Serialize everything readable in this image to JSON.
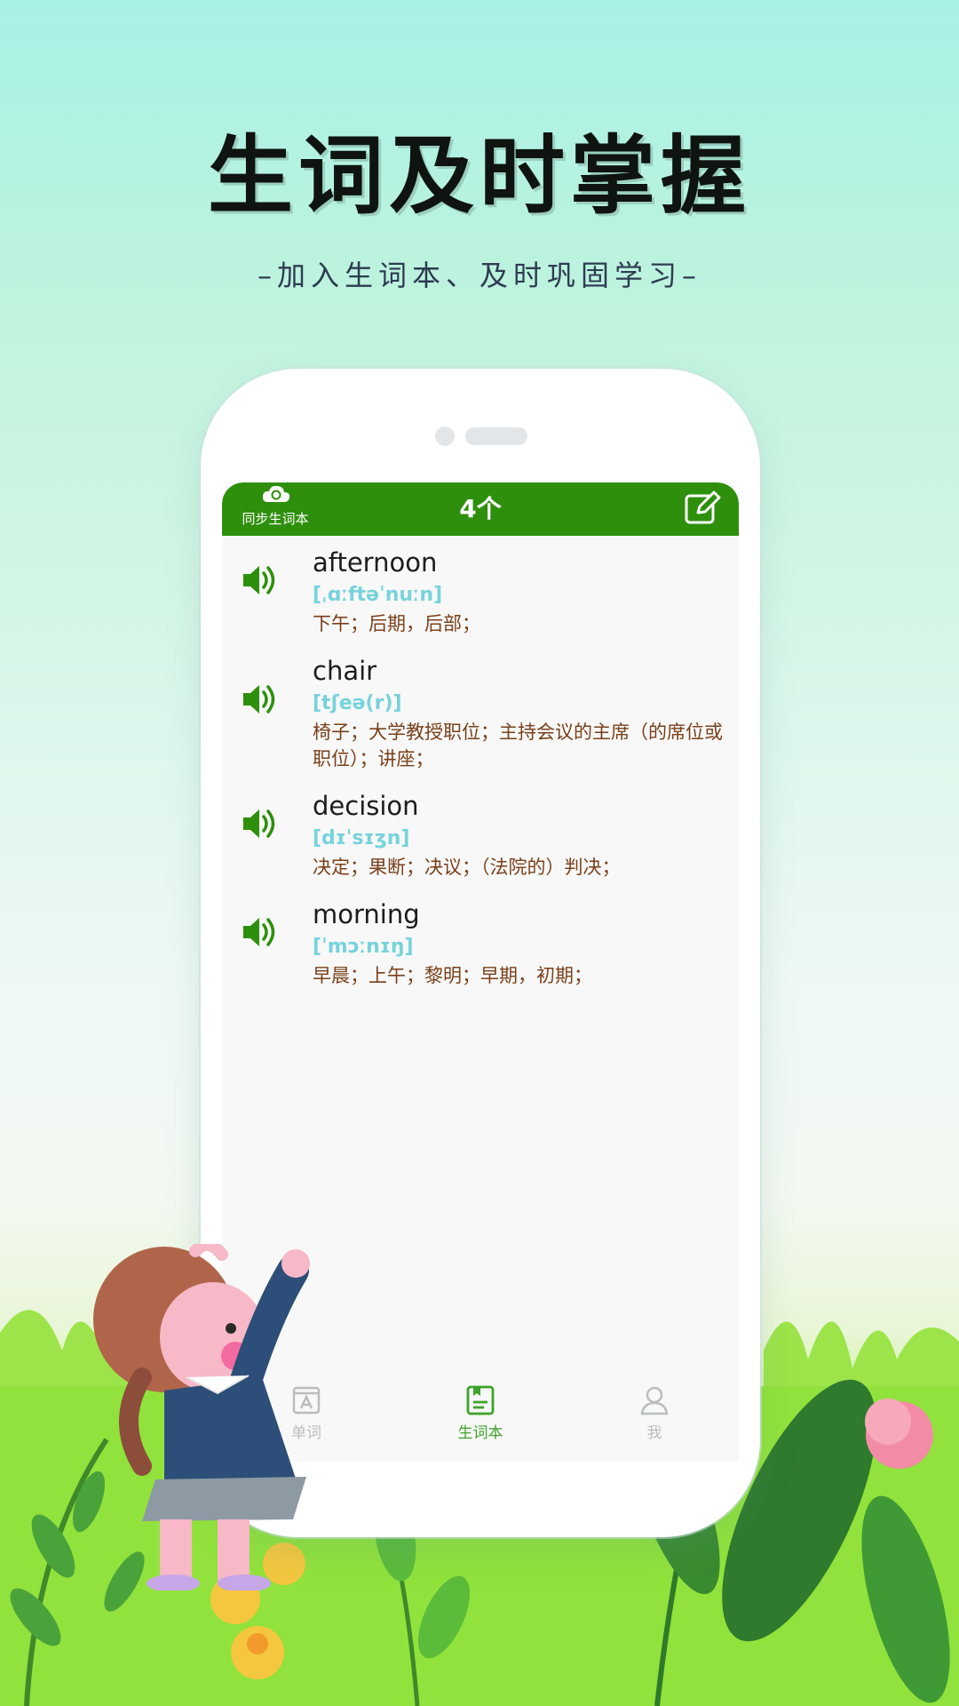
{
  "headline": "生词及时掌握",
  "subline": "–加入生词本、及时巩固学习–",
  "app": {
    "sync_label": "同步生词本",
    "count_label": "4个",
    "words": [
      {
        "word": "afternoon",
        "phonetic": "[ˌɑːftəˈnuːn]",
        "meaning": "下午；后期，后部；"
      },
      {
        "word": "chair",
        "phonetic": "[tʃeə(r)]",
        "meaning": "椅子；大学教授职位；主持会议的主席（的席位或职位）；讲座；"
      },
      {
        "word": "decision",
        "phonetic": "[dɪˈsɪʒn]",
        "meaning": "决定；果断；决议；（法院的）判决；"
      },
      {
        "word": "morning",
        "phonetic": "[ˈmɔːnɪŋ]",
        "meaning": "早晨；上午；黎明；早期，初期；"
      }
    ],
    "tabs": [
      {
        "label": "单词",
        "icon": "word-card-icon"
      },
      {
        "label": "生词本",
        "icon": "notebook-icon"
      },
      {
        "label": "我",
        "icon": "user-icon"
      }
    ],
    "active_tab": "生词本"
  },
  "colors": {
    "brand_green": "#2e8f0c",
    "phonetic": "#77d3dc",
    "meaning": "#7a3f1a",
    "active_tab": "#3ea32a"
  }
}
